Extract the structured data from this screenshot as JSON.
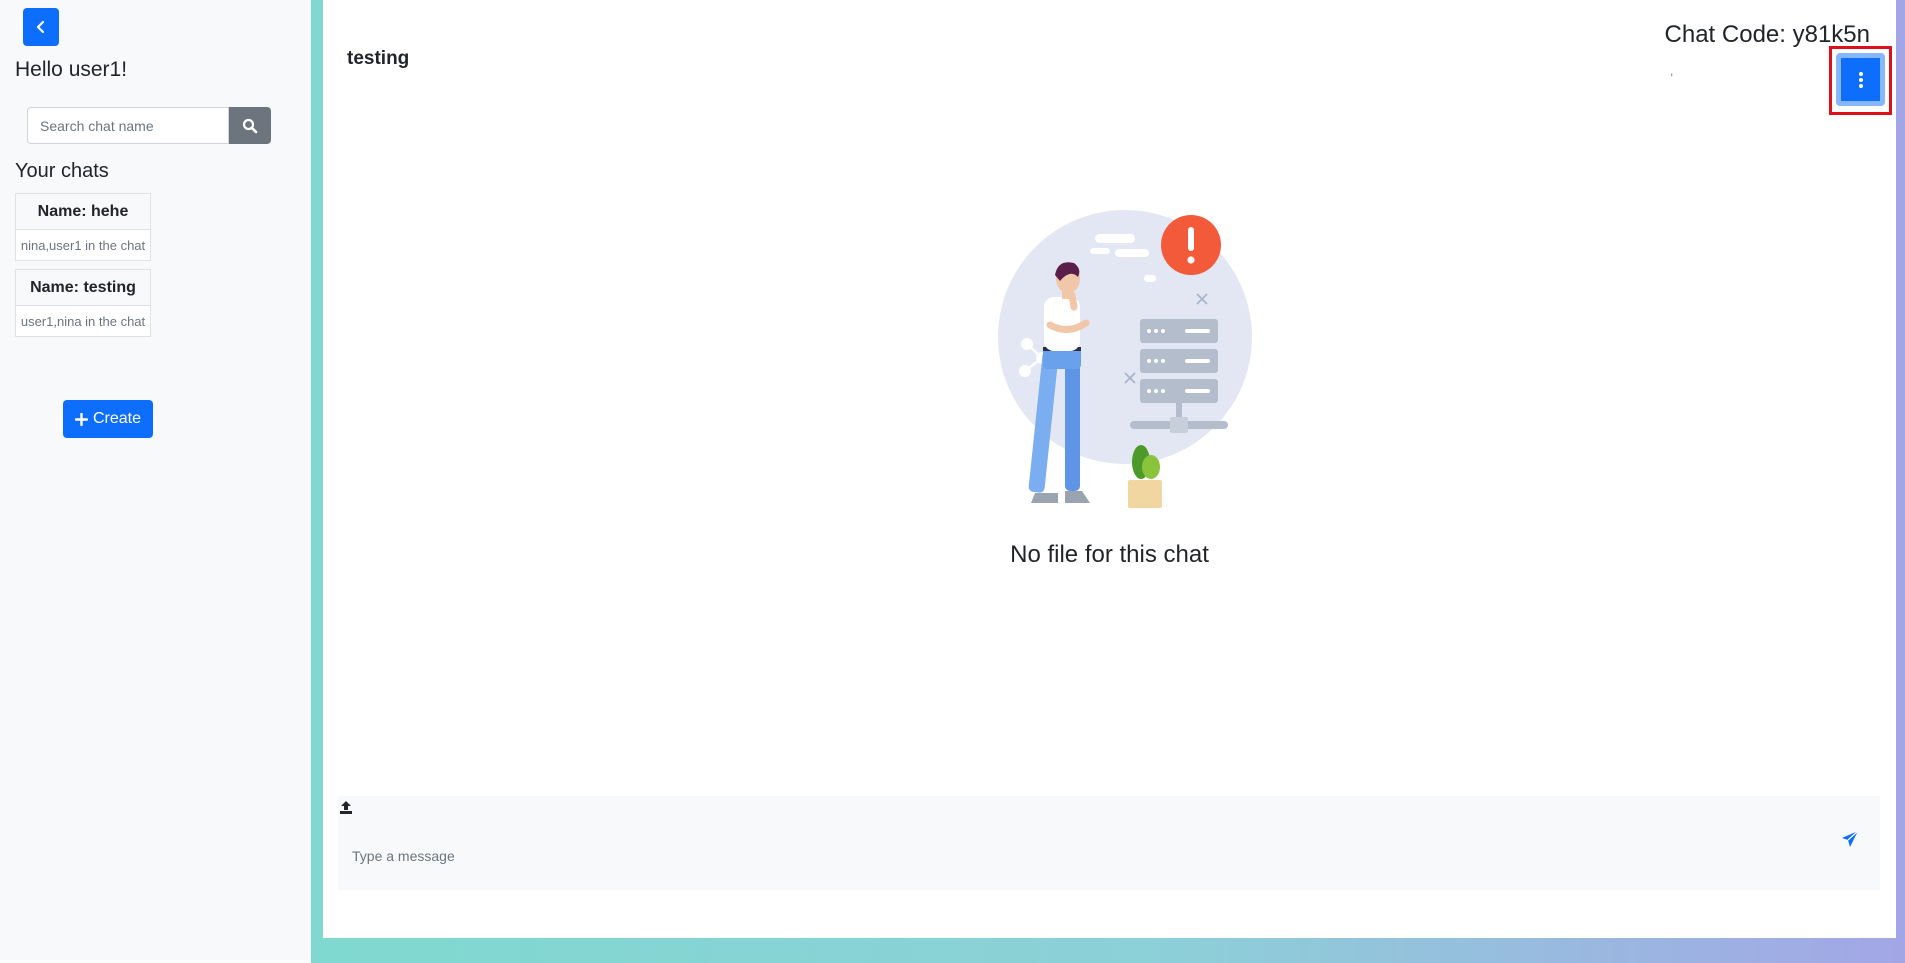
{
  "sidebar": {
    "greeting": "Hello user1!",
    "search": {
      "placeholder": "Search chat name",
      "value": ""
    },
    "chats_heading": "Your chats",
    "chats": [
      {
        "name": "Name: hehe",
        "members": "nina,user1 in the chat"
      },
      {
        "name": "Name: testing",
        "members": "user1,nina in the chat"
      }
    ],
    "create_label": "Create"
  },
  "main": {
    "chat_title": "testing",
    "chat_code": "Chat Code: y81k5n",
    "chat_code_sub": ",",
    "empty_message": "No file for this chat"
  },
  "composer": {
    "placeholder": "Type a message",
    "value": ""
  },
  "icons": {
    "back": "chevron-left-icon",
    "search": "search-icon",
    "create": "plus-icon",
    "menu": "vertical-ellipsis-icon",
    "upload": "upload-icon",
    "send": "paper-plane-icon"
  },
  "colors": {
    "primary": "#0d6efd",
    "secondary": "#6c757d",
    "sidebar_bg": "#f8f9fa",
    "highlight": "#e0101a",
    "frame_gradient_start": "#7fd9d0",
    "frame_gradient_end": "#a3a6e6",
    "alert": "#f25a3a"
  }
}
